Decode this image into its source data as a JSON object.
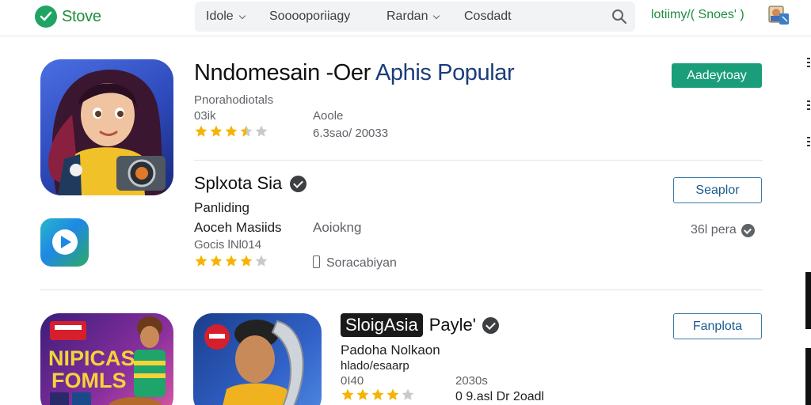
{
  "header": {
    "brand": "Stove",
    "nav": [
      "Idole",
      "Sooooporiiagy",
      "Rardan",
      "Cosdadt"
    ],
    "account_link": "lotiimy/( Snoes' )",
    "colors": {
      "brand": "#1e8e3e",
      "accent": "#1a9e7a"
    }
  },
  "featured": {
    "title_part1": "Nndomesain -Oer",
    "title_part2": "Aphis Popular",
    "developer": "Pnorahodiotals",
    "downloads": "03ik",
    "publisher": "Aoole",
    "date": "6.3sao/ 20033",
    "rating": 3.5,
    "install_button": "Aadeytoay"
  },
  "app2": {
    "title": "Splxota Sia",
    "subtitle": "Panliding",
    "developer": "Aoceh Masiids",
    "category": "Aoiokng",
    "downloads": "Gocis lNl014",
    "device": "Soracabiyan",
    "rating": 4,
    "button": "Seaplor",
    "size": "36l pera"
  },
  "app3": {
    "title_tag": "SloigAsia",
    "title_rest": "Payle'",
    "subtitle": "Padoha Nolkaon",
    "category": "hlado/esaarp",
    "downloads": "0I40",
    "date_label": "2030s",
    "date": "0 9.asl Dr 2oadl",
    "rating": 4,
    "button": "Fanplota",
    "icon_text": "NIPICAS FOMLS"
  }
}
